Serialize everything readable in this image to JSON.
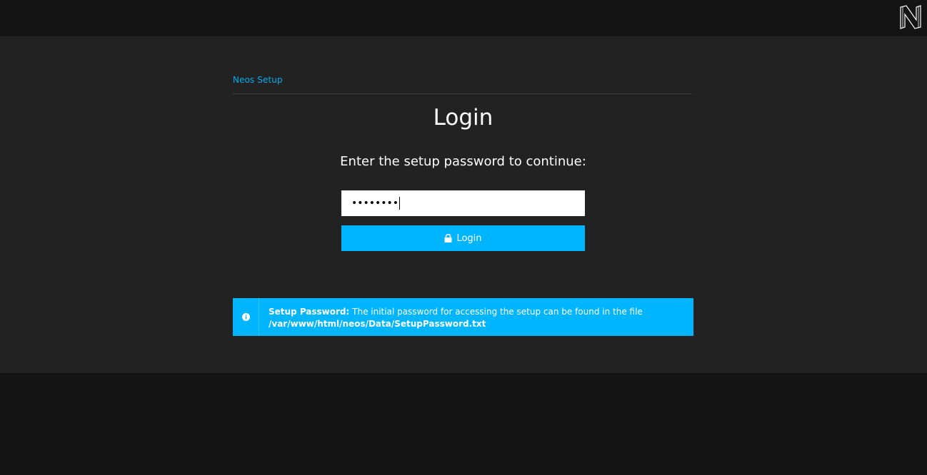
{
  "header": {
    "logo_icon": "neos-logo-icon"
  },
  "breadcrumb": "Neos Setup",
  "page_title": "Login",
  "instructions": "Enter the setup password to continue:",
  "password_field": {
    "value": "••••••••",
    "type": "password"
  },
  "login_button": {
    "label": "Login",
    "icon": "lock-icon"
  },
  "info_box": {
    "icon": "info-icon",
    "title": "Setup Password:",
    "message": " The initial password for accessing the setup can be found in the file",
    "path": "/var/www/html/neos/Data/SetupPassword.txt"
  },
  "colors": {
    "accent": "#00b5ff",
    "link": "#00adee",
    "background": "#222222",
    "chrome": "#141414"
  }
}
